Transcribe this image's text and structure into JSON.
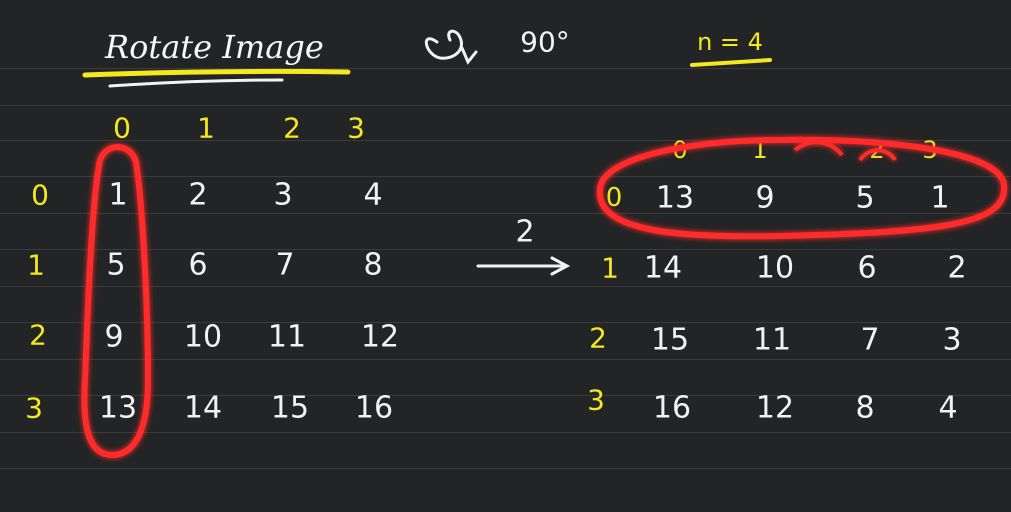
{
  "title": "Rotate Image",
  "angle": "90°",
  "n_label": "n = 4",
  "step_label": "2",
  "colors": {
    "background": "#232425",
    "chalk": "#f2f2f2",
    "highlight": "#f4e81f",
    "red_circle": "#ff2a2a"
  },
  "left": {
    "col_index": [
      "0",
      "1",
      "2",
      "3"
    ],
    "row_index": [
      "0",
      "1",
      "2",
      "3"
    ],
    "rows": [
      [
        "1",
        "2",
        "3",
        "4"
      ],
      [
        "5",
        "6",
        "7",
        "8"
      ],
      [
        "9",
        "10",
        "11",
        "12"
      ],
      [
        "13",
        "14",
        "15",
        "16"
      ]
    ]
  },
  "right": {
    "col_index": [
      "0",
      "1",
      "2",
      "3"
    ],
    "row_index": [
      "0",
      "1",
      "2",
      "3"
    ],
    "rows": [
      [
        "13",
        "9",
        "5",
        "1"
      ],
      [
        "14",
        "10",
        "6",
        "2"
      ],
      [
        "15",
        "11",
        "7",
        "3"
      ],
      [
        "16",
        "12",
        "8",
        "4"
      ]
    ]
  }
}
